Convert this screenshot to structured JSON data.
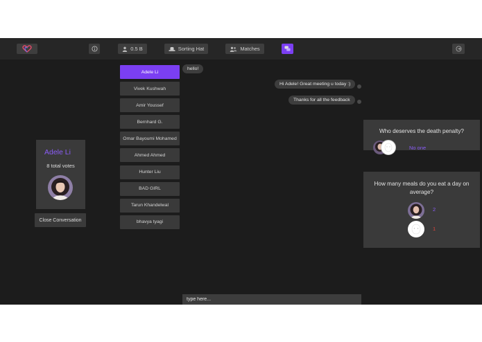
{
  "topbar": {
    "logo_icon": "heart-logo-icon",
    "info_icon": "info-icon",
    "balance": "0.5 B",
    "sorting_hat": "Sorting Hat",
    "matches": "Matches",
    "logout_icon": "logout-icon"
  },
  "profile": {
    "name": "Adele Li",
    "votes": "8 total votes",
    "close_button": "Close Conversation"
  },
  "contacts": [
    "Adele Li",
    "Vivek Kushwah",
    "Amir Youssef",
    "Bernhard G.",
    "Omar Bayoumi Mohamed",
    "Ahmed Ahmed",
    "Hunter Liu",
    "BAD GIRL",
    "Tarun Khandelwal",
    "bhavya tyagi"
  ],
  "active_contact": 0,
  "messages": {
    "received_1": "hello!",
    "sent_1": "Hi Adele! Great meeting u today :)",
    "sent_2": "Thanks for all the feedback"
  },
  "chat_input": {
    "placeholder": "type here...",
    "value": ""
  },
  "questions": [
    {
      "title": "Who deserves the death penalty?",
      "answer": "No one"
    },
    {
      "title": "How many meals do you eat a day on average?",
      "answers": [
        "2",
        "1"
      ]
    }
  ],
  "colors": {
    "accent": "#7b3ff2",
    "accent_text": "#8a5cf6",
    "red": "#e0443a",
    "background": "#1c1c1c",
    "panel": "#3a3a3a"
  }
}
